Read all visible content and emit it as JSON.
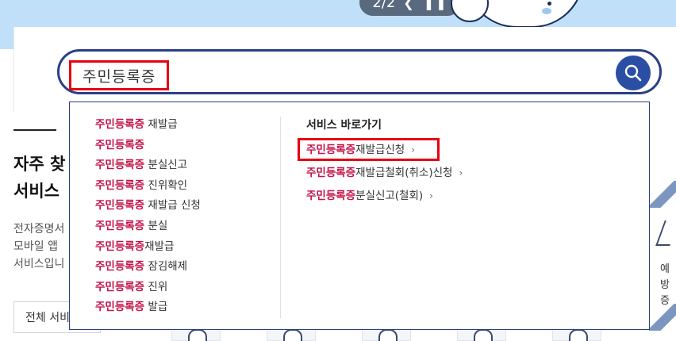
{
  "banner": {
    "pager_text": "2/2",
    "prev_icon": "chevron-left-icon",
    "pause_icon": "pause-icon"
  },
  "search": {
    "query": "주민등록증",
    "button_icon": "search-icon"
  },
  "suggestions": {
    "items": [
      {
        "highlight": "주민등록증",
        "rest": " 재발급"
      },
      {
        "highlight": "주민등록증",
        "rest": ""
      },
      {
        "highlight": "주민등록증",
        "rest": " 분실신고"
      },
      {
        "highlight": "주민등록증",
        "rest": " 진위확인"
      },
      {
        "highlight": "주민등록증",
        "rest": " 재발급 신청"
      },
      {
        "highlight": "주민등록증",
        "rest": " 분실"
      },
      {
        "highlight": "주민등록증",
        "rest": "재발급"
      },
      {
        "highlight": "주민등록증",
        "rest": " 잠김해제"
      },
      {
        "highlight": "주민등록증",
        "rest": " 진위"
      },
      {
        "highlight": "주민등록증",
        "rest": " 발급"
      }
    ]
  },
  "service_shortcuts": {
    "title": "서비스 바로가기",
    "items": [
      {
        "highlight": "주민등록증",
        "rest": "재발급신청"
      },
      {
        "highlight": "주민등록증",
        "rest": "재발급철회(취소)신청"
      },
      {
        "highlight": "주민등록증",
        "rest": "분실신고(철회)"
      }
    ],
    "chevron": "›"
  },
  "background": {
    "title_line1": "자주 찾",
    "title_line2": "서비스",
    "desc_line1": "전자증명서",
    "desc_line2": "모바일 앱",
    "desc_line3": "서비스입니",
    "all_button": "전체 서비",
    "side_card_line1": "예방",
    "side_card_line2": "증"
  },
  "colors": {
    "accent_navy": "#2a3f86",
    "highlight_red": "#c4144a",
    "focus_box_red": "#e60012",
    "hero_blue": "#bfe0f8"
  }
}
